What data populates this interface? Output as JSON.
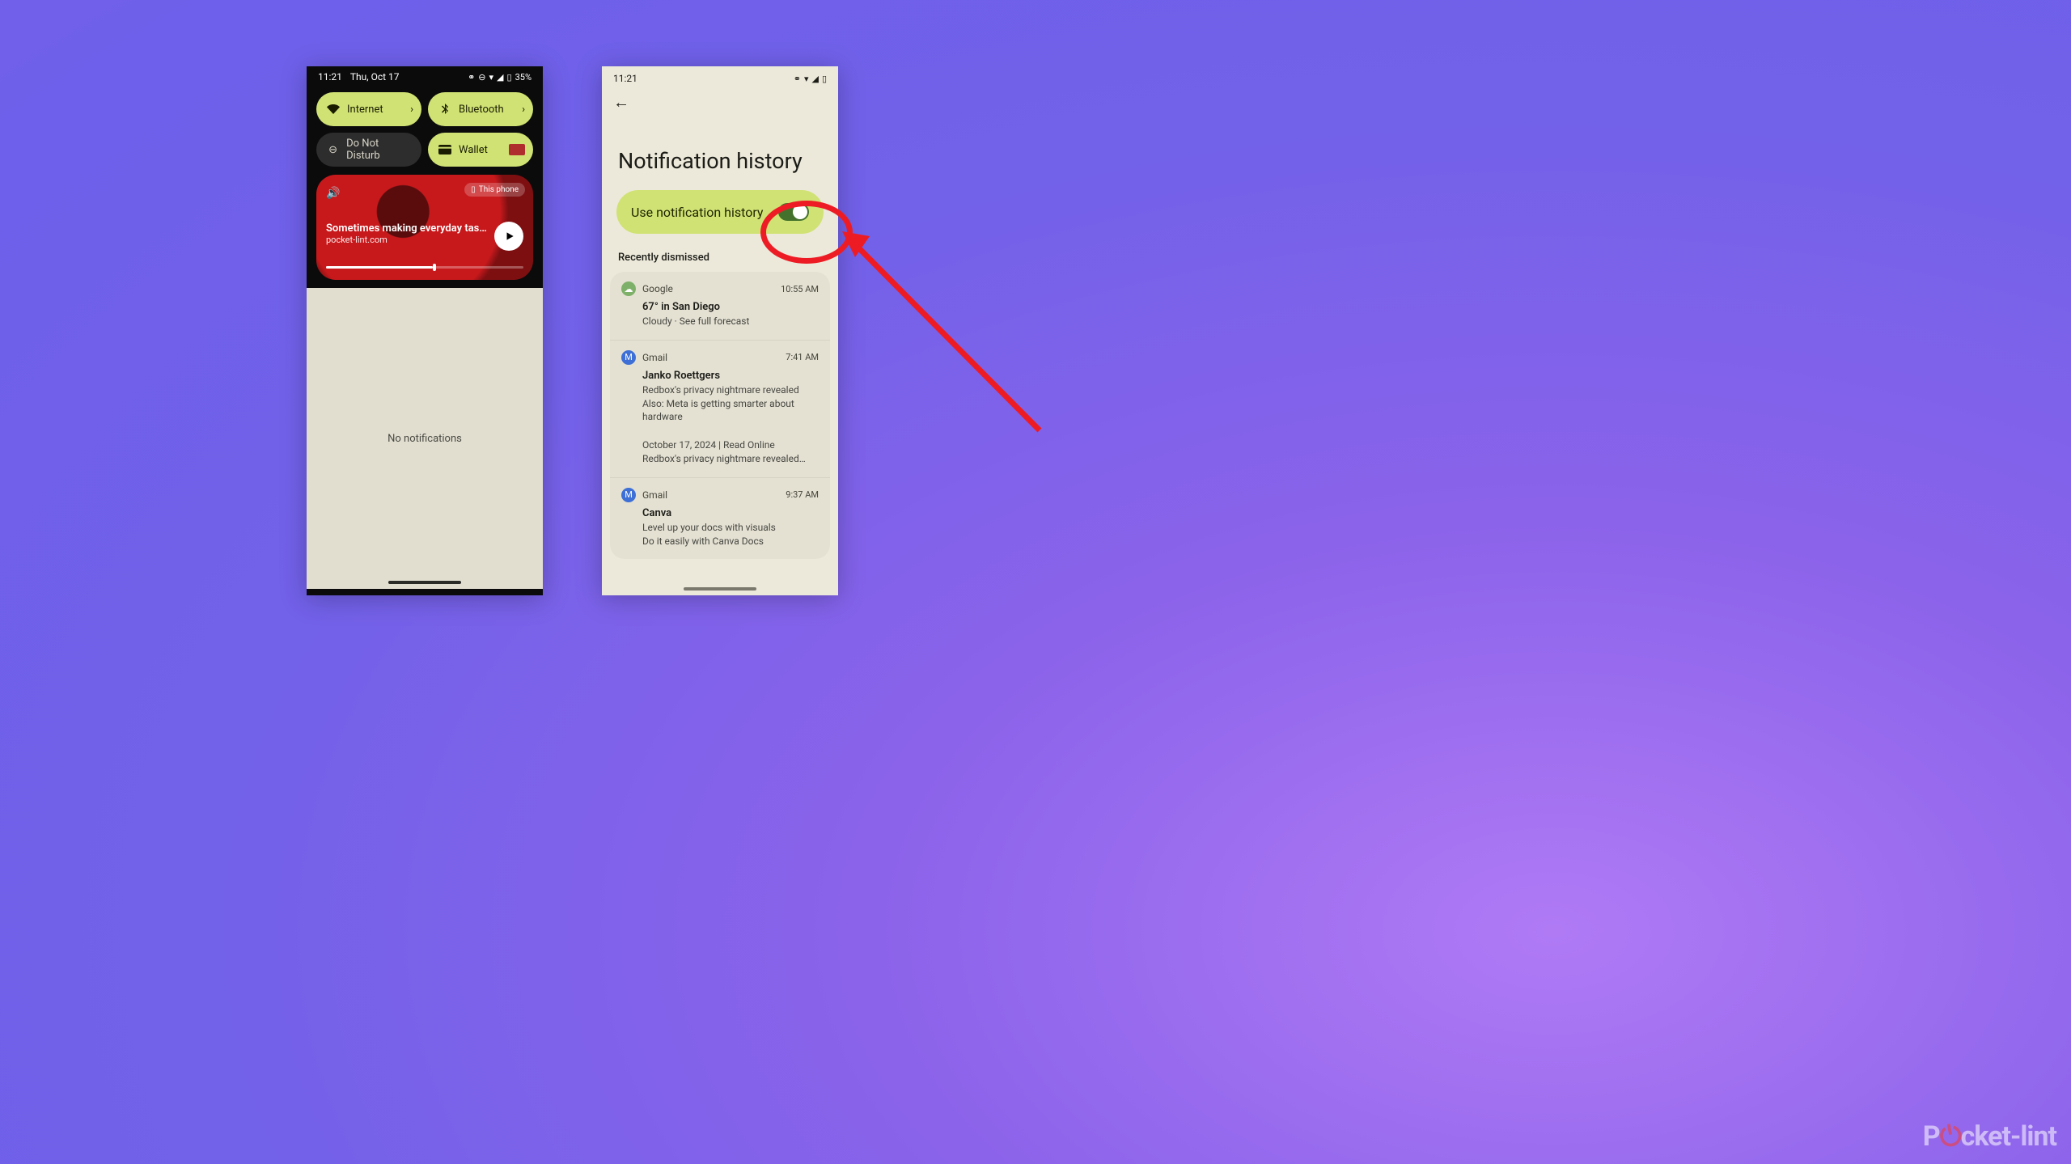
{
  "left": {
    "status": {
      "time": "11:21",
      "date": "Thu, Oct 17",
      "battery": "35%"
    },
    "tiles": {
      "internet": {
        "label": "Internet"
      },
      "bluetooth": {
        "label": "Bluetooth"
      },
      "dnd": {
        "label": "Do Not Disturb"
      },
      "wallet": {
        "label": "Wallet"
      }
    },
    "media": {
      "device_pill": "This phone",
      "title": "Sometimes making everyday tasks s…",
      "source": "pocket-lint.com"
    },
    "empty_text": "No notifications"
  },
  "right": {
    "status": {
      "time": "11:21"
    },
    "title": "Notification history",
    "toggle_label": "Use notification history",
    "section": "Recently dismissed",
    "items": [
      {
        "app": "Google",
        "icon": "ic-google",
        "glyph": "☁",
        "time": "10:55 AM",
        "title": "67° in San Diego",
        "body": "Cloudy · See full forecast"
      },
      {
        "app": "Gmail",
        "icon": "ic-gmail",
        "glyph": "M",
        "time": "7:41 AM",
        "title": "Janko Roettgers",
        "body": "Redbox's privacy nightmare revealed\nAlso: Meta is getting smarter about hardware",
        "body2": "October 17, 2024    |    Read Online\nRedbox's privacy nightmare revealed…"
      },
      {
        "app": "Gmail",
        "icon": "ic-gmail",
        "glyph": "M",
        "time": "9:37 AM",
        "title": "Canva",
        "body": "Level up your docs with visuals\nDo it easily with Canva Docs"
      }
    ]
  },
  "watermark": {
    "pre": "P",
    "accent": "⏻",
    "post": "cket-lint"
  }
}
